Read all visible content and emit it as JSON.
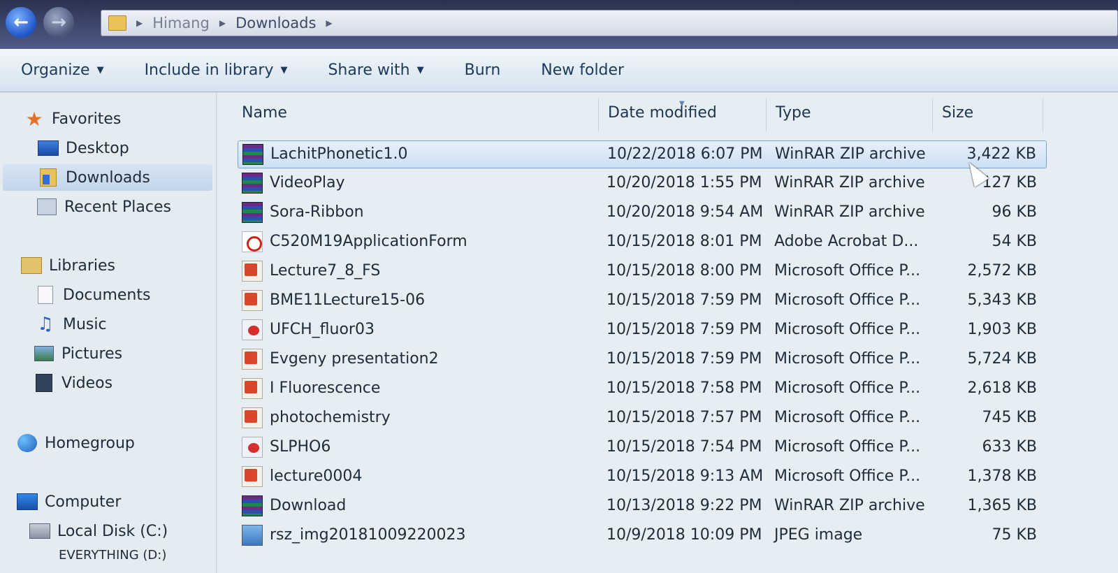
{
  "address": {
    "breadcrumb": [
      "Himang",
      "Downloads"
    ]
  },
  "toolbar": {
    "organize": "Organize",
    "include_in_library": "Include in library",
    "share_with": "Share with",
    "burn": "Burn",
    "new_folder": "New folder"
  },
  "sidebar": {
    "favorites": "Favorites",
    "desktop": "Desktop",
    "downloads": "Downloads",
    "recent_places": "Recent Places",
    "libraries": "Libraries",
    "documents": "Documents",
    "music": "Music",
    "pictures": "Pictures",
    "videos": "Videos",
    "homegroup": "Homegroup",
    "computer": "Computer",
    "local_disk": "Local Disk (C:)",
    "everything_drive": "EVERYTHING (D:)"
  },
  "columns": {
    "name": "Name",
    "date_modified": "Date modified",
    "type": "Type",
    "size": "Size"
  },
  "files": [
    {
      "name": "LachitPhonetic1.0",
      "date": "10/22/2018 6:07 PM",
      "type": "WinRAR ZIP archive",
      "size": "3,422 KB",
      "icon": "zip-archive-icon"
    },
    {
      "name": "VideoPlay",
      "date": "10/20/2018 1:55 PM",
      "type": "WinRAR ZIP archive",
      "size": "127 KB",
      "icon": "zip-archive-icon"
    },
    {
      "name": "Sora-Ribbon",
      "date": "10/20/2018 9:54 AM",
      "type": "WinRAR ZIP archive",
      "size": "96 KB",
      "icon": "zip-archive-icon"
    },
    {
      "name": "C520M19ApplicationForm",
      "date": "10/15/2018 8:01 PM",
      "type": "Adobe Acrobat D...",
      "size": "54 KB",
      "icon": "pdf-icon"
    },
    {
      "name": "Lecture7_8_FS",
      "date": "10/15/2018 8:00 PM",
      "type": "Microsoft Office P...",
      "size": "2,572 KB",
      "icon": "powerpoint-icon"
    },
    {
      "name": "BME11Lecture15-06",
      "date": "10/15/2018 7:59 PM",
      "type": "Microsoft Office P...",
      "size": "5,343 KB",
      "icon": "powerpoint-icon"
    },
    {
      "name": "UFCH_fluor03",
      "date": "10/15/2018 7:59 PM",
      "type": "Microsoft Office P...",
      "size": "1,903 KB",
      "icon": "powerpoint-show-icon"
    },
    {
      "name": "Evgeny presentation2",
      "date": "10/15/2018 7:59 PM",
      "type": "Microsoft Office P...",
      "size": "5,724 KB",
      "icon": "powerpoint-icon"
    },
    {
      "name": "I Fluorescence",
      "date": "10/15/2018 7:58 PM",
      "type": "Microsoft Office P...",
      "size": "2,618 KB",
      "icon": "powerpoint-icon"
    },
    {
      "name": "photochemistry",
      "date": "10/15/2018 7:57 PM",
      "type": "Microsoft Office P...",
      "size": "745 KB",
      "icon": "powerpoint-icon"
    },
    {
      "name": "SLPHO6",
      "date": "10/15/2018 7:54 PM",
      "type": "Microsoft Office P...",
      "size": "633 KB",
      "icon": "powerpoint-show-icon"
    },
    {
      "name": "lecture0004",
      "date": "10/15/2018 9:13 AM",
      "type": "Microsoft Office P...",
      "size": "1,378 KB",
      "icon": "powerpoint-icon"
    },
    {
      "name": "Download",
      "date": "10/13/2018 9:22 PM",
      "type": "WinRAR ZIP archive",
      "size": "1,365 KB",
      "icon": "zip-archive-icon"
    },
    {
      "name": "rsz_img20181009220023",
      "date": "10/9/2018 10:09 PM",
      "type": "JPEG image",
      "size": "75 KB",
      "icon": "jpeg-image-icon"
    }
  ],
  "selected_file": "LachitPhonetic1.0"
}
